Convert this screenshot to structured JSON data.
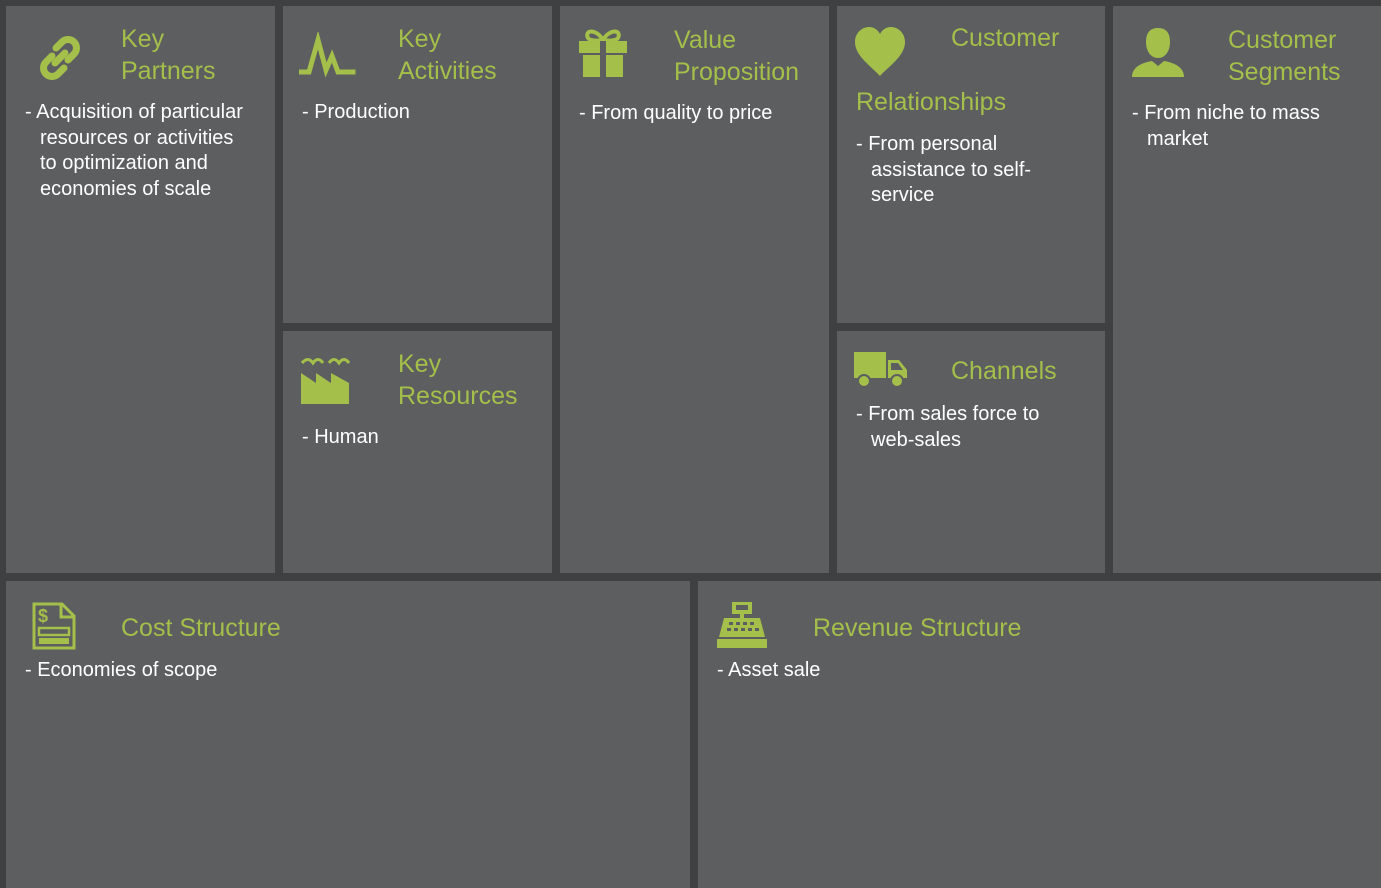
{
  "canvas": {
    "accent_color": "#a4bf4a",
    "panel_color": "#5d5e60",
    "gap_color": "#3f4042",
    "text_color": "#ffffff"
  },
  "blocks": {
    "key_partners": {
      "icon": "chain-link-icon",
      "title_line1": "Key",
      "title_line2": "Partners",
      "items": [
        "Acquisition of particular resources or activities to optimization and economies of scale"
      ]
    },
    "key_activities": {
      "icon": "activity-pulse-icon",
      "title_line1": "Key",
      "title_line2": "Activities",
      "items": [
        "Production"
      ]
    },
    "key_resources": {
      "icon": "factory-icon",
      "title_line1": "Key",
      "title_line2": "Resources",
      "items": [
        "Human"
      ]
    },
    "value_proposition": {
      "icon": "gift-icon",
      "title_line1": "Value",
      "title_line2": "Proposition",
      "items": [
        "From quality to price"
      ]
    },
    "customer_relationships": {
      "icon": "heart-icon",
      "title_line1": "Customer",
      "title_line2": "Relationships",
      "items": [
        "From personal assistance to self-service"
      ]
    },
    "channels": {
      "icon": "truck-icon",
      "title": "Channels",
      "items": [
        "From sales force to web-sales"
      ]
    },
    "customer_segments": {
      "icon": "user-icon",
      "title_line1": "Customer",
      "title_line2": "Segments",
      "items": [
        "From niche to mass market"
      ]
    },
    "cost_structure": {
      "icon": "invoice-icon",
      "title": "Cost Structure",
      "items": [
        "Economies of scope"
      ]
    },
    "revenue_structure": {
      "icon": "cash-register-icon",
      "title": "Revenue Structure",
      "items": [
        "Asset sale"
      ]
    }
  }
}
